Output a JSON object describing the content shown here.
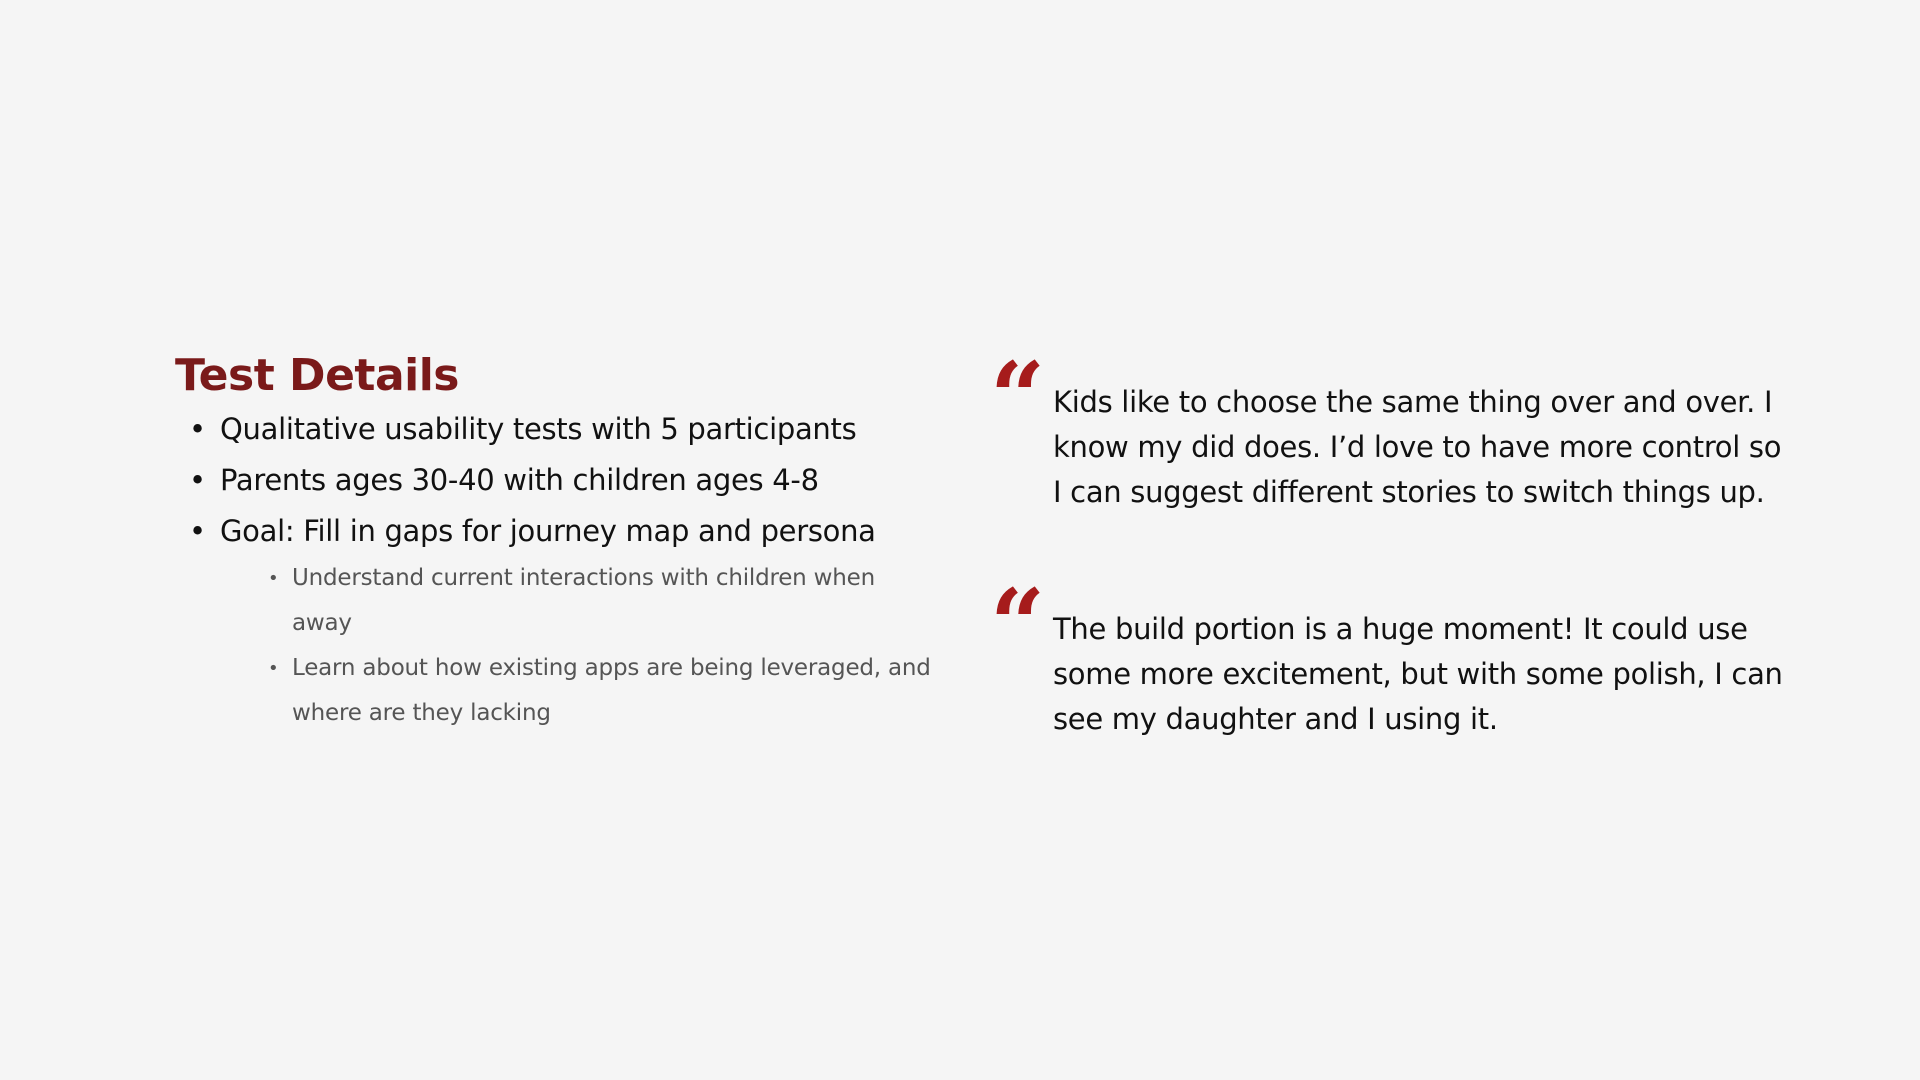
{
  "colors": {
    "background": "#f5f5f5",
    "title": "#7a1a1a",
    "quote_mark": "#a61c1c",
    "text": "#111111",
    "sub_text": "#555555"
  },
  "left": {
    "title": "Test Details",
    "bullets": [
      "Qualitative usability tests with 5 participants",
      "Parents ages 30-40 with children ages 4-8",
      "Goal: Fill in gaps for journey map and persona"
    ],
    "sub_bullets": [
      "Understand current interactions with children when away",
      "Learn about how existing apps are being leveraged, and where are they lacking"
    ],
    "bullet_glyph": "•"
  },
  "quotes": [
    {
      "mark": "“",
      "icon": "quote-mark-icon",
      "text": "Kids like to choose the same thing over and over. I know my did does. I’d love to have more control so I can suggest different stories to switch things up."
    },
    {
      "mark": "“",
      "icon": "quote-mark-icon",
      "text": "The build portion is a huge moment! It could use some more excitement, but with some polish, I can see my daughter and I using it."
    }
  ]
}
